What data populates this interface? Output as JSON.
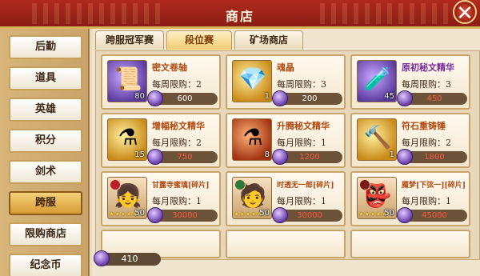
{
  "header": {
    "title": "商店",
    "close_glyph": "✕"
  },
  "sidebar": {
    "items": [
      {
        "label": "后勤"
      },
      {
        "label": "道具"
      },
      {
        "label": "英雄"
      },
      {
        "label": "积分"
      },
      {
        "label": "剑术"
      },
      {
        "label": "跨服",
        "active": true
      },
      {
        "label": "限购商店"
      },
      {
        "label": "纪念币"
      }
    ]
  },
  "tabs": [
    {
      "label": "跨服冠军赛"
    },
    {
      "label": "段位赛",
      "active": true
    },
    {
      "label": "矿场商店"
    }
  ],
  "items": [
    {
      "name": "密文卷轴",
      "limit": "每周限购：2",
      "count": "80",
      "price": "600",
      "icon": "scroll-icon",
      "color": "purple"
    },
    {
      "name": "魂晶",
      "limit": "每周限购：3",
      "count": "1",
      "price": "200",
      "icon": "crystal-icon",
      "color": "gold"
    },
    {
      "name": "原初秘文精华",
      "limit": "每周限购：3",
      "count": "45",
      "price": "450",
      "icon": "potion-icon",
      "color": "purple"
    },
    {
      "name": "增幅秘文精华",
      "limit": "每月限购：2",
      "count": "15",
      "price": "750",
      "icon": "potion-icon",
      "color": "gold"
    },
    {
      "name": "升腾秘文精华",
      "limit": "每月限购：1",
      "count": "8",
      "price": "1200",
      "icon": "potion-icon",
      "color": "red"
    },
    {
      "name": "符石重铸锤",
      "limit": "每月限购：2",
      "count": "1",
      "price": "1800",
      "icon": "hammer-icon",
      "color": "gold"
    },
    {
      "name": "甘露寺蜜璃[碎片]",
      "limit": "每月限购：1",
      "count": "50",
      "price": "30000",
      "icon": "character-portrait",
      "color": "char",
      "stars": "★★★★★"
    },
    {
      "name": "时透无一郎[碎片]",
      "limit": "每月限购：1",
      "count": "50",
      "price": "30000",
      "icon": "character-portrait",
      "color": "char",
      "stars": "★★★★★"
    },
    {
      "name": "魇梦[下弦一][碎片]",
      "limit": "每月限购：1",
      "count": "50",
      "price": "45000",
      "icon": "character-portrait",
      "color": "char",
      "stars": "★★★★★"
    }
  ],
  "currency": {
    "amount": "410"
  }
}
